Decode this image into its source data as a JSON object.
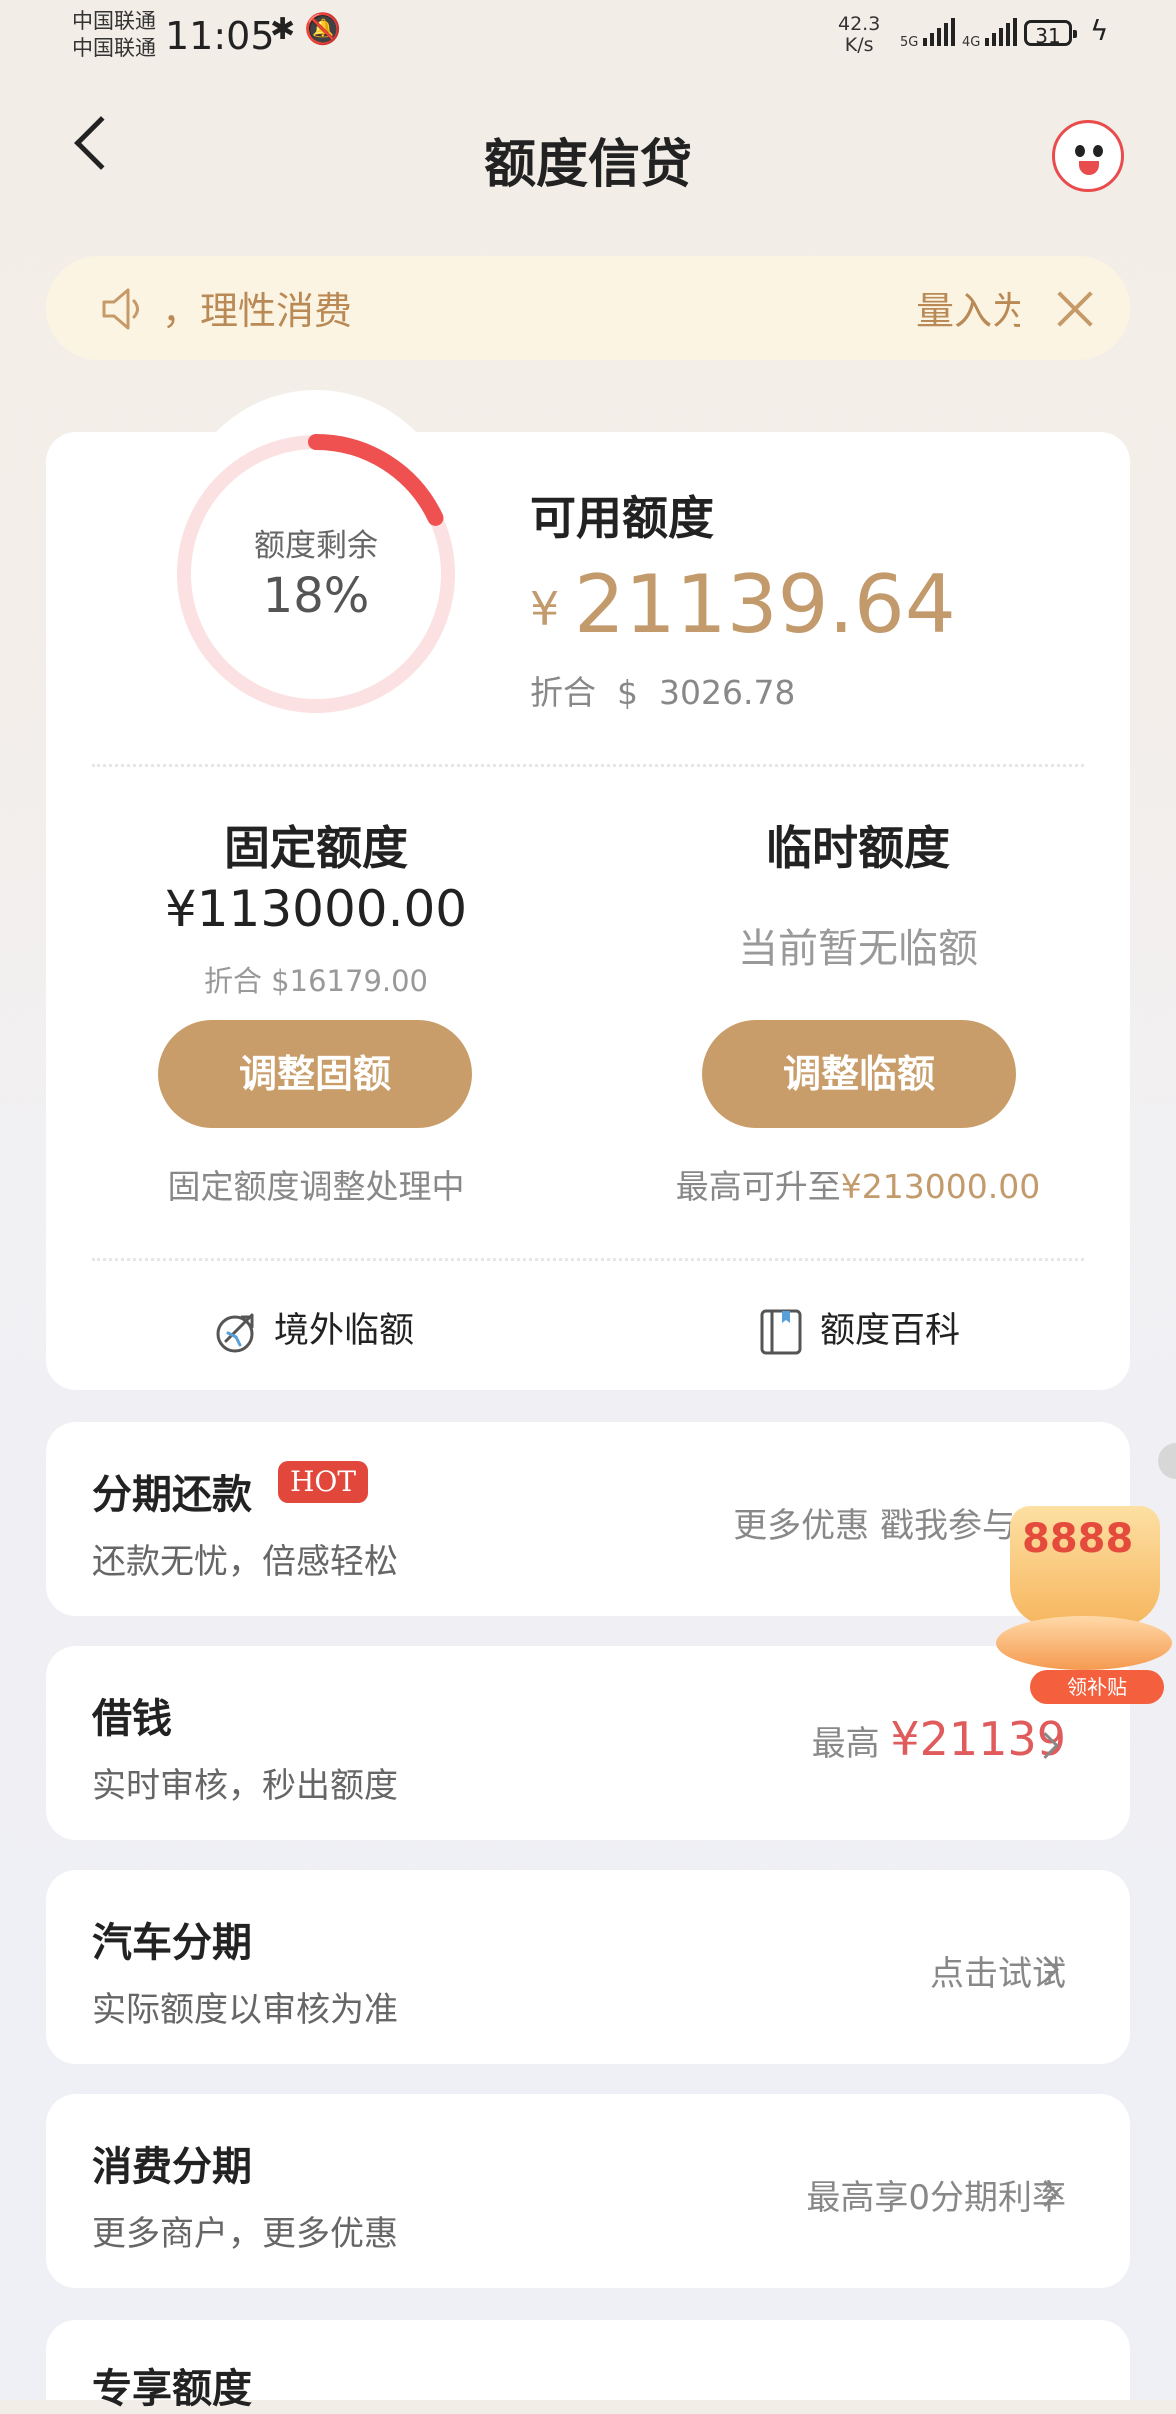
{
  "status_bar": {
    "carrier_1": "中国联通",
    "carrier_2": "中国联通",
    "time": "11:05",
    "net_speed_value": "42.3",
    "net_speed_unit": "K/s",
    "sig1_label": "5G",
    "sig2_label": "4G",
    "battery": "31"
  },
  "header": {
    "title": "额度信贷"
  },
  "notice": {
    "text": "，理性消费",
    "scroll_text": "量入为"
  },
  "credit": {
    "ring_label": "额度剩余",
    "ring_percent_text": "18%",
    "ring_fraction": 0.18,
    "available_label": "可用额度",
    "currency_symbol": "¥",
    "available_amount": "21139.64",
    "converted_label": "折合",
    "converted_symbol": "$",
    "converted_amount": "3026.78"
  },
  "fixed": {
    "title": "固定额度",
    "amount": "¥113000.00",
    "converted": "折合 $16179.00",
    "button": "调整固额",
    "note": "固定额度调整处理中"
  },
  "temporary": {
    "title": "临时额度",
    "status": "当前暂无临额",
    "button": "调整临额",
    "note_prefix": "最高可升至",
    "note_amount": "¥213000.00"
  },
  "links": {
    "overseas": "境外临额",
    "encyclopedia": "额度百科"
  },
  "rows": {
    "installment_repay": {
      "title": "分期还款",
      "badge": "HOT",
      "subtitle": "还款无忧，倍感轻松",
      "right": "更多优惠 戳我参与"
    },
    "borrow": {
      "title": "借钱",
      "subtitle": "实时审核，秒出额度",
      "right_prefix": "最高",
      "right_amount": "¥21139"
    },
    "car": {
      "title": "汽车分期",
      "subtitle": "实际额度以审核为准",
      "right": "点击试试"
    },
    "consumer": {
      "title": "消费分期",
      "subtitle": "更多商户，更多优惠",
      "right": "最高享0分期利率"
    },
    "exclusive": {
      "title": "专享额度"
    }
  },
  "floating_coupon": {
    "number": "8888",
    "label": "领补贴"
  },
  "colors": {
    "accent_gold": "#c99d6a",
    "ring_red": "#ee5150",
    "ring_track": "#fbe1e1",
    "hot_red": "#e2473b"
  },
  "icons": [
    "back-arrow-icon",
    "mascot-icon",
    "speaker-icon",
    "close-icon",
    "overseas-plane-icon",
    "book-icon",
    "chevron-right-icon"
  ]
}
